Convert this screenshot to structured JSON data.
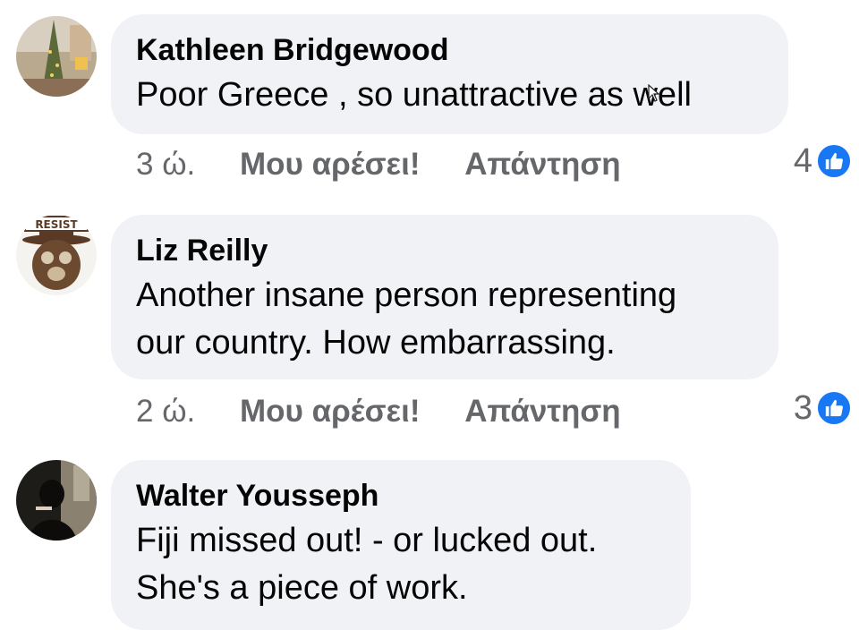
{
  "comments": [
    {
      "author": "Kathleen Bridgewood",
      "text": "Poor Greece , so unattractive as well",
      "time": "3 ώ.",
      "like_label": "Μου αρέσει!",
      "reply_label": "Απάντηση",
      "reaction_count": "4",
      "avatar_icon": "christmas-tree-photo-avatar"
    },
    {
      "author": "Liz Reilly",
      "text_line1": "Another insane person representing",
      "text_line2": "our country. How embarrassing.",
      "time": "2 ώ.",
      "like_label": "Μου αρέσει!",
      "reply_label": "Απάντηση",
      "reaction_count": "3",
      "avatar_icon": "resist-bear-avatar",
      "avatar_text": "RESIST"
    },
    {
      "author": "Walter Yousseph",
      "text_line1": "Fiji missed out! - or lucked out.",
      "text_line2": "She's a piece of work.",
      "avatar_icon": "silhouette-photo-avatar"
    }
  ],
  "colors": {
    "bubble": "#f0f2f5",
    "meta_text": "#65676b",
    "like_badge": "#1877f2"
  }
}
